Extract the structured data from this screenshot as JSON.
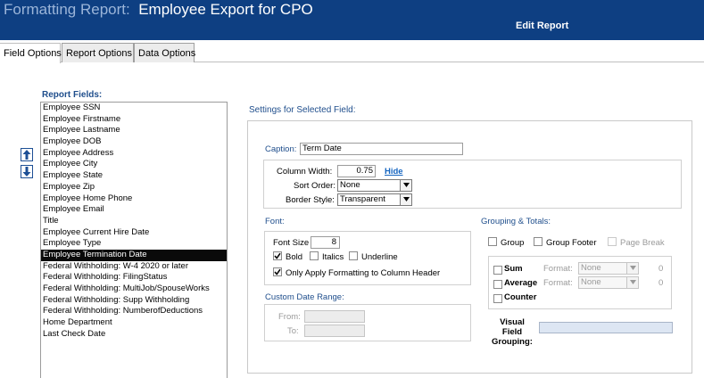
{
  "header": {
    "title_prefix": "Formatting Report:",
    "title_name": "Employee Export for CPO",
    "edit_link": "Edit Report"
  },
  "tabs": [
    {
      "label": "Field Options",
      "active": true
    },
    {
      "label": "Report Options",
      "active": false
    },
    {
      "label": "Data Options",
      "active": false
    }
  ],
  "report_fields": {
    "label": "Report Fields:",
    "items": [
      "Employee SSN",
      "Employee Firstname",
      "Employee Lastname",
      "Employee DOB",
      "Employee Address",
      "Employee City",
      "Employee State",
      "Employee Zip",
      "Employee Home Phone",
      "Employee Email",
      "Title",
      "Employee Current Hire Date",
      "Employee Type",
      "Employee Termination Date",
      "Federal Withholding: W-4 2020 or later",
      "Federal Withholding: FilingStatus",
      "Federal Withholding: MultiJob/SpouseWorks",
      "Federal Withholding: Supp Withholding",
      "Federal Withholding: NumberofDeductions",
      "Home Department",
      "Last Check Date"
    ],
    "selected": "Employee Termination Date"
  },
  "settings": {
    "label": "Settings for Selected Field:",
    "caption_label": "Caption:",
    "caption_value": "Term Date",
    "column_width_label": "Column Width:",
    "column_width_value": "0.75",
    "hide_link": "Hide",
    "sort_order_label": "Sort Order:",
    "sort_order_value": "None",
    "border_style_label": "Border Style:",
    "border_style_value": "Transparent"
  },
  "font": {
    "label": "Font:",
    "size_label": "Font Size",
    "size_value": "8",
    "bold_label": "Bold",
    "bold_checked": true,
    "italics_label": "Italics",
    "italics_checked": false,
    "underline_label": "Underline",
    "underline_checked": false,
    "header_only_label": "Only Apply Formatting to Column Header",
    "header_only_checked": true
  },
  "custom_date_range": {
    "label": "Custom Date Range:",
    "from_label": "From:",
    "to_label": "To:",
    "from_value": "",
    "to_value": ""
  },
  "grouping": {
    "label": "Grouping & Totals:",
    "group_label": "Group",
    "group_footer_label": "Group Footer",
    "page_break_label": "Page Break",
    "sum_label": "Sum",
    "average_label": "Average",
    "counter_label": "Counter",
    "format_label": "Format:",
    "sum_format": "None",
    "average_format": "None",
    "sum_value": "0",
    "average_value": "0",
    "visual_grouping_label": "Visual Field Grouping:"
  },
  "colors": {
    "header_bg": "#0e3f82",
    "section_label": "#1f4e8c",
    "link": "#1565c0",
    "selected_row": "#0a0a0a"
  }
}
